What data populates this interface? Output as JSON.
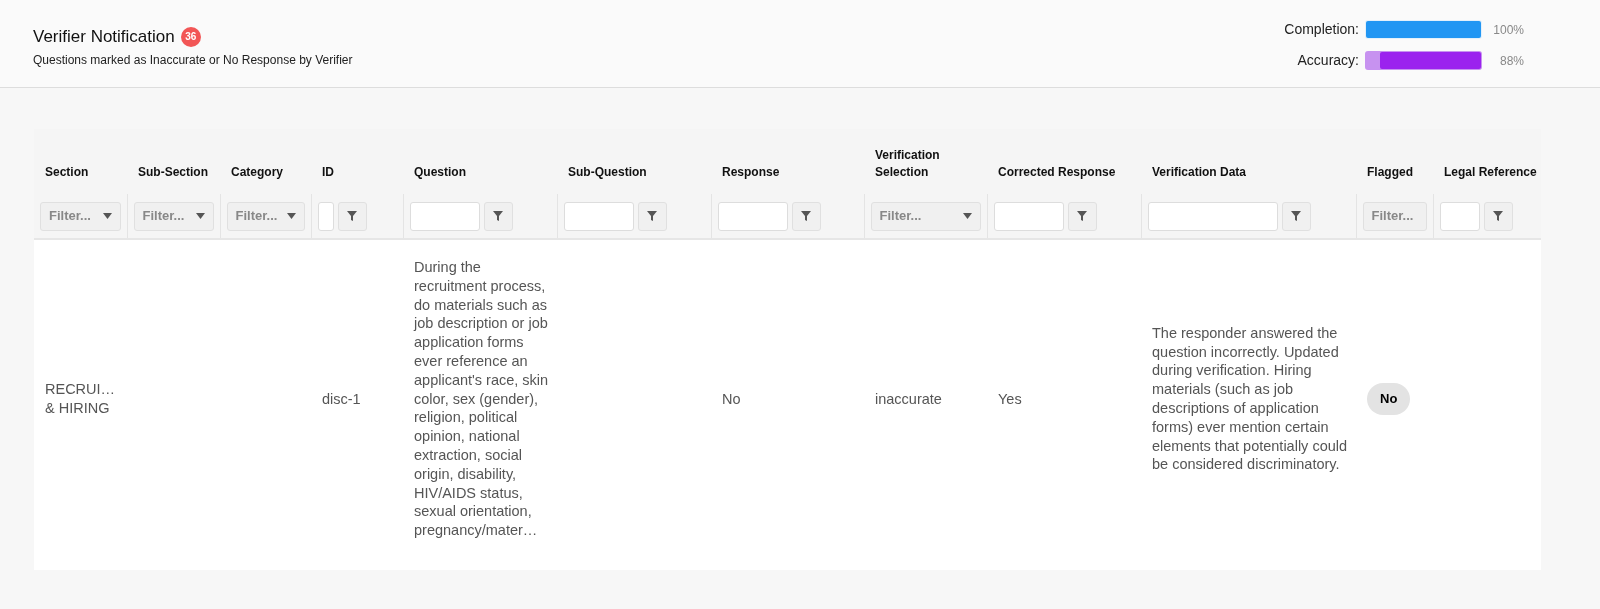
{
  "header": {
    "title": "Verifier Notification",
    "badge": "36",
    "subtitle": "Questions marked as Inaccurate or No Response by Verifier"
  },
  "metrics": [
    {
      "label": "Completion:",
      "level": 1.0,
      "reading": "100%",
      "kind": "completion"
    },
    {
      "label": "Accuracy:",
      "level": 0.88,
      "reading": "88%",
      "kind": "accuracy"
    }
  ],
  "table": {
    "columns": [
      {
        "label": "Section",
        "filter": {
          "kind": "select",
          "placeholder": "Filter..."
        }
      },
      {
        "label": "Sub-Section",
        "filter": {
          "kind": "select",
          "placeholder": "Filter..."
        }
      },
      {
        "label": "Category",
        "filter": {
          "kind": "select",
          "placeholder": "Filter..."
        }
      },
      {
        "label": "ID",
        "filter": {
          "kind": "text"
        }
      },
      {
        "label": "Question",
        "filter": {
          "kind": "text"
        }
      },
      {
        "label": "Sub-Question",
        "filter": {
          "kind": "text"
        }
      },
      {
        "label": "Response",
        "filter": {
          "kind": "text"
        }
      },
      {
        "label": "Verification Selection",
        "filter": {
          "kind": "select",
          "placeholder": "Filter..."
        }
      },
      {
        "label": "Corrected Response",
        "filter": {
          "kind": "text"
        }
      },
      {
        "label": "Verification Data",
        "filter": {
          "kind": "text"
        }
      },
      {
        "label": "Flagged",
        "filter": {
          "kind": "select",
          "placeholder": "Filter..."
        }
      },
      {
        "label": "Legal Reference",
        "filter": {
          "kind": "text"
        }
      }
    ],
    "rows": [
      {
        "cells": [
          {
            "kind": "text",
            "text": "RECRUI… & HIRING"
          },
          {
            "kind": "empty"
          },
          {
            "kind": "empty"
          },
          {
            "kind": "text",
            "text": "disc-1"
          },
          {
            "kind": "text",
            "text": "During the recruitment process, do materials such as job description or job application forms ever reference an applicant's race, skin color, sex (gender), religion, political opinion, national extraction, social origin, disability, HIV/AIDS status, sexual orientation, pregnancy/mater…"
          },
          {
            "kind": "empty"
          },
          {
            "kind": "text",
            "text": "No"
          },
          {
            "kind": "text",
            "text": "inaccurate"
          },
          {
            "kind": "text",
            "text": "Yes"
          },
          {
            "kind": "text",
            "text": "The responder answered the question incorrectly. Updated during verification. Hiring materials (such as job descriptions of application forms) ever mention certain elements that potentially could be considered discriminatory."
          },
          {
            "kind": "pill",
            "text": "No"
          },
          {
            "kind": "empty"
          }
        ]
      }
    ]
  }
}
